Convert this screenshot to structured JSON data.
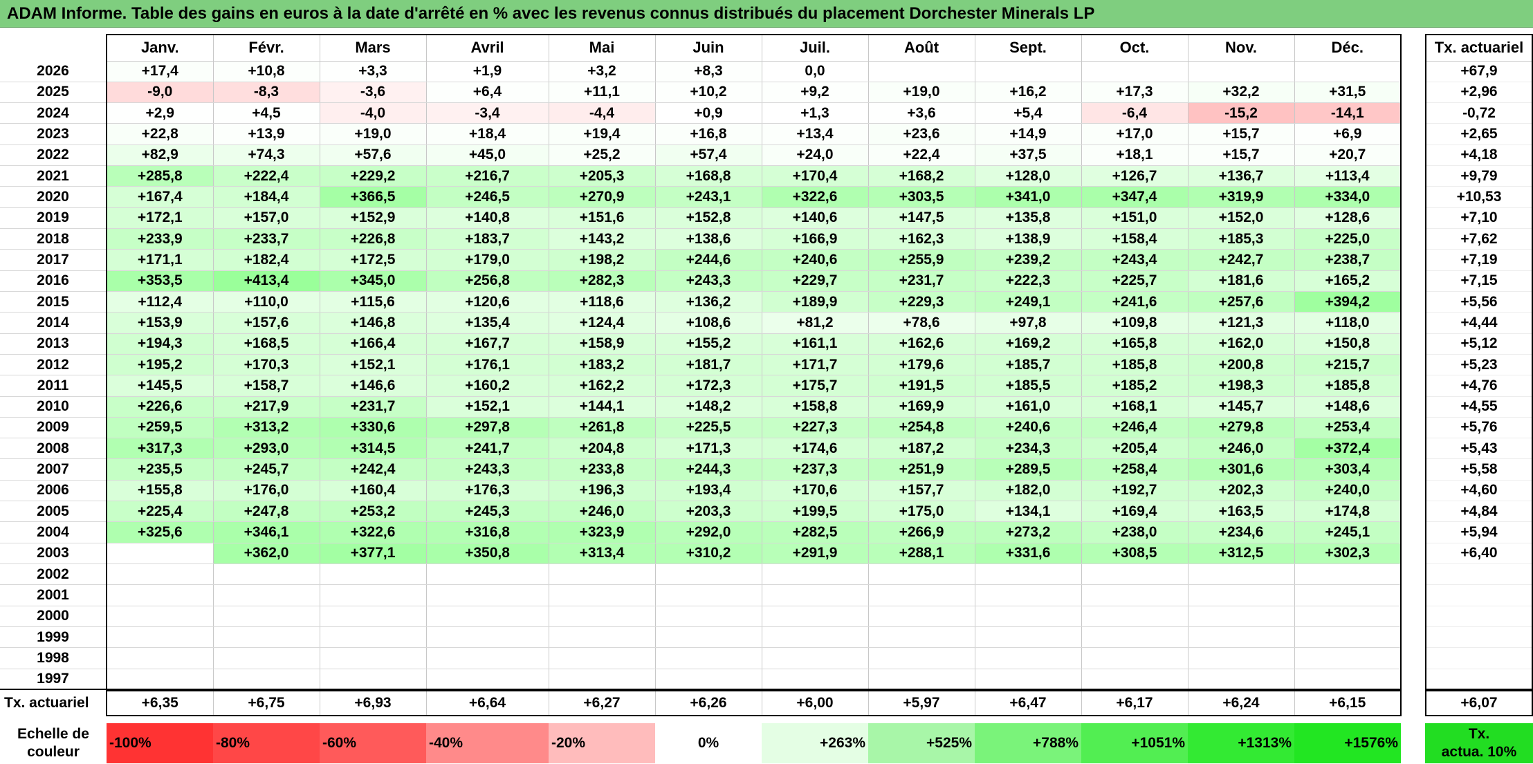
{
  "title": "ADAM Informe. Table des gains en euros à la date d'arrêté en % avec les revenus connus distribués du placement Dorchester Minerals LP",
  "months": [
    "Janv.",
    "Févr.",
    "Mars",
    "Avril",
    "Mai",
    "Juin",
    "Juil.",
    "Août",
    "Sept.",
    "Oct.",
    "Nov.",
    "Déc."
  ],
  "side_header": "Tx. actuariel",
  "years": [
    "2026",
    "2025",
    "2024",
    "2023",
    "2022",
    "2021",
    "2020",
    "2019",
    "2018",
    "2017",
    "2016",
    "2015",
    "2014",
    "2013",
    "2012",
    "2011",
    "2010",
    "2009",
    "2008",
    "2007",
    "2006",
    "2005",
    "2004",
    "2003",
    "2002",
    "2001",
    "2000",
    "1999",
    "1998",
    "1997"
  ],
  "grid": [
    [
      "+17,4",
      "+10,8",
      "+3,3",
      "+1,9",
      "+3,2",
      "+8,3",
      "0,0",
      "",
      "",
      "",
      "",
      ""
    ],
    [
      "-9,0",
      "-8,3",
      "-3,6",
      "+6,4",
      "+11,1",
      "+10,2",
      "+9,2",
      "+19,0",
      "+16,2",
      "+17,3",
      "+32,2",
      "+31,5"
    ],
    [
      "+2,9",
      "+4,5",
      "-4,0",
      "-3,4",
      "-4,4",
      "+0,9",
      "+1,3",
      "+3,6",
      "+5,4",
      "-6,4",
      "-15,2",
      "-14,1"
    ],
    [
      "+22,8",
      "+13,9",
      "+19,0",
      "+18,4",
      "+19,4",
      "+16,8",
      "+13,4",
      "+23,6",
      "+14,9",
      "+17,0",
      "+15,7",
      "+6,9"
    ],
    [
      "+82,9",
      "+74,3",
      "+57,6",
      "+45,0",
      "+25,2",
      "+57,4",
      "+24,0",
      "+22,4",
      "+37,5",
      "+18,1",
      "+15,7",
      "+20,7"
    ],
    [
      "+285,8",
      "+222,4",
      "+229,2",
      "+216,7",
      "+205,3",
      "+168,8",
      "+170,4",
      "+168,2",
      "+128,0",
      "+126,7",
      "+136,7",
      "+113,4"
    ],
    [
      "+167,4",
      "+184,4",
      "+366,5",
      "+246,5",
      "+270,9",
      "+243,1",
      "+322,6",
      "+303,5",
      "+341,0",
      "+347,4",
      "+319,9",
      "+334,0"
    ],
    [
      "+172,1",
      "+157,0",
      "+152,9",
      "+140,8",
      "+151,6",
      "+152,8",
      "+140,6",
      "+147,5",
      "+135,8",
      "+151,0",
      "+152,0",
      "+128,6"
    ],
    [
      "+233,9",
      "+233,7",
      "+226,8",
      "+183,7",
      "+143,2",
      "+138,6",
      "+166,9",
      "+162,3",
      "+138,9",
      "+158,4",
      "+185,3",
      "+225,0"
    ],
    [
      "+171,1",
      "+182,4",
      "+172,5",
      "+179,0",
      "+198,2",
      "+244,6",
      "+240,6",
      "+255,9",
      "+239,2",
      "+243,4",
      "+242,7",
      "+238,7"
    ],
    [
      "+353,5",
      "+413,4",
      "+345,0",
      "+256,8",
      "+282,3",
      "+243,3",
      "+229,7",
      "+231,7",
      "+222,3",
      "+225,7",
      "+181,6",
      "+165,2"
    ],
    [
      "+112,4",
      "+110,0",
      "+115,6",
      "+120,6",
      "+118,6",
      "+136,2",
      "+189,9",
      "+229,3",
      "+249,1",
      "+241,6",
      "+257,6",
      "+394,2"
    ],
    [
      "+153,9",
      "+157,6",
      "+146,8",
      "+135,4",
      "+124,4",
      "+108,6",
      "+81,2",
      "+78,6",
      "+97,8",
      "+109,8",
      "+121,3",
      "+118,0"
    ],
    [
      "+194,3",
      "+168,5",
      "+166,4",
      "+167,7",
      "+158,9",
      "+155,2",
      "+161,1",
      "+162,6",
      "+169,2",
      "+165,8",
      "+162,0",
      "+150,8"
    ],
    [
      "+195,2",
      "+170,3",
      "+152,1",
      "+176,1",
      "+183,2",
      "+181,7",
      "+171,7",
      "+179,6",
      "+185,7",
      "+185,8",
      "+200,8",
      "+215,7"
    ],
    [
      "+145,5",
      "+158,7",
      "+146,6",
      "+160,2",
      "+162,2",
      "+172,3",
      "+175,7",
      "+191,5",
      "+185,5",
      "+185,2",
      "+198,3",
      "+185,8"
    ],
    [
      "+226,6",
      "+217,9",
      "+231,7",
      "+152,1",
      "+144,1",
      "+148,2",
      "+158,8",
      "+169,9",
      "+161,0",
      "+168,1",
      "+145,7",
      "+148,6"
    ],
    [
      "+259,5",
      "+313,2",
      "+330,6",
      "+297,8",
      "+261,8",
      "+225,5",
      "+227,3",
      "+254,8",
      "+240,6",
      "+246,4",
      "+279,8",
      "+253,4"
    ],
    [
      "+317,3",
      "+293,0",
      "+314,5",
      "+241,7",
      "+204,8",
      "+171,3",
      "+174,6",
      "+187,2",
      "+234,3",
      "+205,4",
      "+246,0",
      "+372,4"
    ],
    [
      "+235,5",
      "+245,7",
      "+242,4",
      "+243,3",
      "+233,8",
      "+244,3",
      "+237,3",
      "+251,9",
      "+289,5",
      "+258,4",
      "+301,6",
      "+303,4"
    ],
    [
      "+155,8",
      "+176,0",
      "+160,4",
      "+176,3",
      "+196,3",
      "+193,4",
      "+170,6",
      "+157,7",
      "+182,0",
      "+192,7",
      "+202,3",
      "+240,0"
    ],
    [
      "+225,4",
      "+247,8",
      "+253,2",
      "+245,3",
      "+246,0",
      "+203,3",
      "+199,5",
      "+175,0",
      "+134,1",
      "+169,4",
      "+163,5",
      "+174,8"
    ],
    [
      "+325,6",
      "+346,1",
      "+322,6",
      "+316,8",
      "+323,9",
      "+292,0",
      "+282,5",
      "+266,9",
      "+273,2",
      "+238,0",
      "+234,6",
      "+245,1"
    ],
    [
      "",
      "+362,0",
      "+377,1",
      "+350,8",
      "+313,4",
      "+310,2",
      "+291,9",
      "+288,1",
      "+331,6",
      "+308,5",
      "+312,5",
      "+302,3"
    ],
    [
      "",
      "",
      "",
      "",
      "",
      "",
      "",
      "",
      "",
      "",
      "",
      ""
    ],
    [
      "",
      "",
      "",
      "",
      "",
      "",
      "",
      "",
      "",
      "",
      "",
      ""
    ],
    [
      "",
      "",
      "",
      "",
      "",
      "",
      "",
      "",
      "",
      "",
      "",
      ""
    ],
    [
      "",
      "",
      "",
      "",
      "",
      "",
      "",
      "",
      "",
      "",
      "",
      ""
    ],
    [
      "",
      "",
      "",
      "",
      "",
      "",
      "",
      "",
      "",
      "",
      "",
      ""
    ],
    [
      "",
      "",
      "",
      "",
      "",
      "",
      "",
      "",
      "",
      "",
      "",
      ""
    ]
  ],
  "side_values": [
    "+67,9",
    "+2,96",
    "-0,72",
    "+2,65",
    "+4,18",
    "+9,79",
    "+10,53",
    "+7,10",
    "+7,62",
    "+7,19",
    "+7,15",
    "+5,56",
    "+4,44",
    "+5,12",
    "+5,23",
    "+4,76",
    "+4,55",
    "+5,76",
    "+5,43",
    "+5,58",
    "+4,60",
    "+4,84",
    "+5,94",
    "+6,40",
    "",
    "",
    "",
    "",
    "",
    ""
  ],
  "avg_row": {
    "label": "Tx. actuariel",
    "values": [
      "+6,35",
      "+6,75",
      "+6,93",
      "+6,64",
      "+6,27",
      "+6,26",
      "+6,00",
      "+5,97",
      "+6,47",
      "+6,17",
      "+6,24",
      "+6,15"
    ],
    "total": "+6,07"
  },
  "scale": {
    "label_line1": "Echelle de",
    "label_line2": "couleur",
    "items": [
      {
        "text": "-100%",
        "color": "#ff3333"
      },
      {
        "text": "-80%",
        "color": "#ff4747"
      },
      {
        "text": "-60%",
        "color": "#ff5a5a"
      },
      {
        "text": "-40%",
        "color": "#ff8a8a"
      },
      {
        "text": "-20%",
        "color": "#ffbcbc"
      },
      {
        "text": "0%",
        "color": "#ffffff"
      },
      {
        "text": "+263%",
        "color": "#e4fee4"
      },
      {
        "text": "+525%",
        "color": "#a8f6a8"
      },
      {
        "text": "+788%",
        "color": "#7af37a"
      },
      {
        "text": "+1051%",
        "color": "#52ee52"
      },
      {
        "text": "+1313%",
        "color": "#33ea33"
      },
      {
        "text": "+1576%",
        "color": "#22e622"
      }
    ],
    "side_line1": "Tx.",
    "side_line2": "actua. 10%",
    "side_color": "#22dd22"
  }
}
